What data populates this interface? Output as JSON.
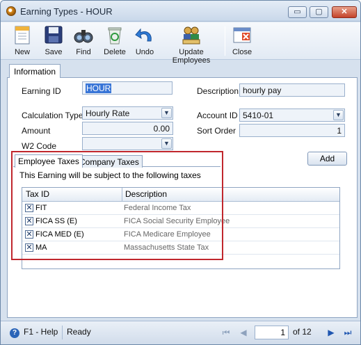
{
  "window": {
    "title": "Earning Types - HOUR",
    "minimize": "▭",
    "maximize": "▢",
    "close": "✕"
  },
  "toolbar": {
    "new": "New",
    "save": "Save",
    "find": "Find",
    "delete": "Delete",
    "undo": "Undo",
    "update_employees": "Update Employees",
    "close": "Close"
  },
  "tabs": {
    "information": "Information"
  },
  "form": {
    "earning_id_label": "Earning ID",
    "earning_id_value": "HOUR",
    "description_label": "Description",
    "description_value": "hourly pay",
    "calc_type_label": "Calculation Type",
    "calc_type_value": "Hourly Rate",
    "account_id_label": "Account ID",
    "account_id_value": "5410-01",
    "amount_label": "Amount",
    "amount_value": "0.00",
    "sort_order_label": "Sort Order",
    "sort_order_value": "1",
    "w2_code_label": "W2 Code",
    "w2_code_value": "",
    "add_button": "Add"
  },
  "taxes": {
    "tabs": [
      "Employee Taxes",
      "Company Taxes"
    ],
    "hint": "This Earning will be subject to the following taxes",
    "columns": [
      "Tax ID",
      "Description"
    ],
    "rows": [
      {
        "tax_id": "FIT",
        "description": "Federal Income Tax"
      },
      {
        "tax_id": "FICA SS (E)",
        "description": "FICA Social Security Employee"
      },
      {
        "tax_id": "FICA MED (E)",
        "description": "FICA Medicare Employee"
      },
      {
        "tax_id": "MA",
        "description": "Massachusetts State Tax"
      }
    ]
  },
  "status": {
    "help": "F1 - Help",
    "state": "Ready",
    "page": "1",
    "of": "of 12"
  }
}
